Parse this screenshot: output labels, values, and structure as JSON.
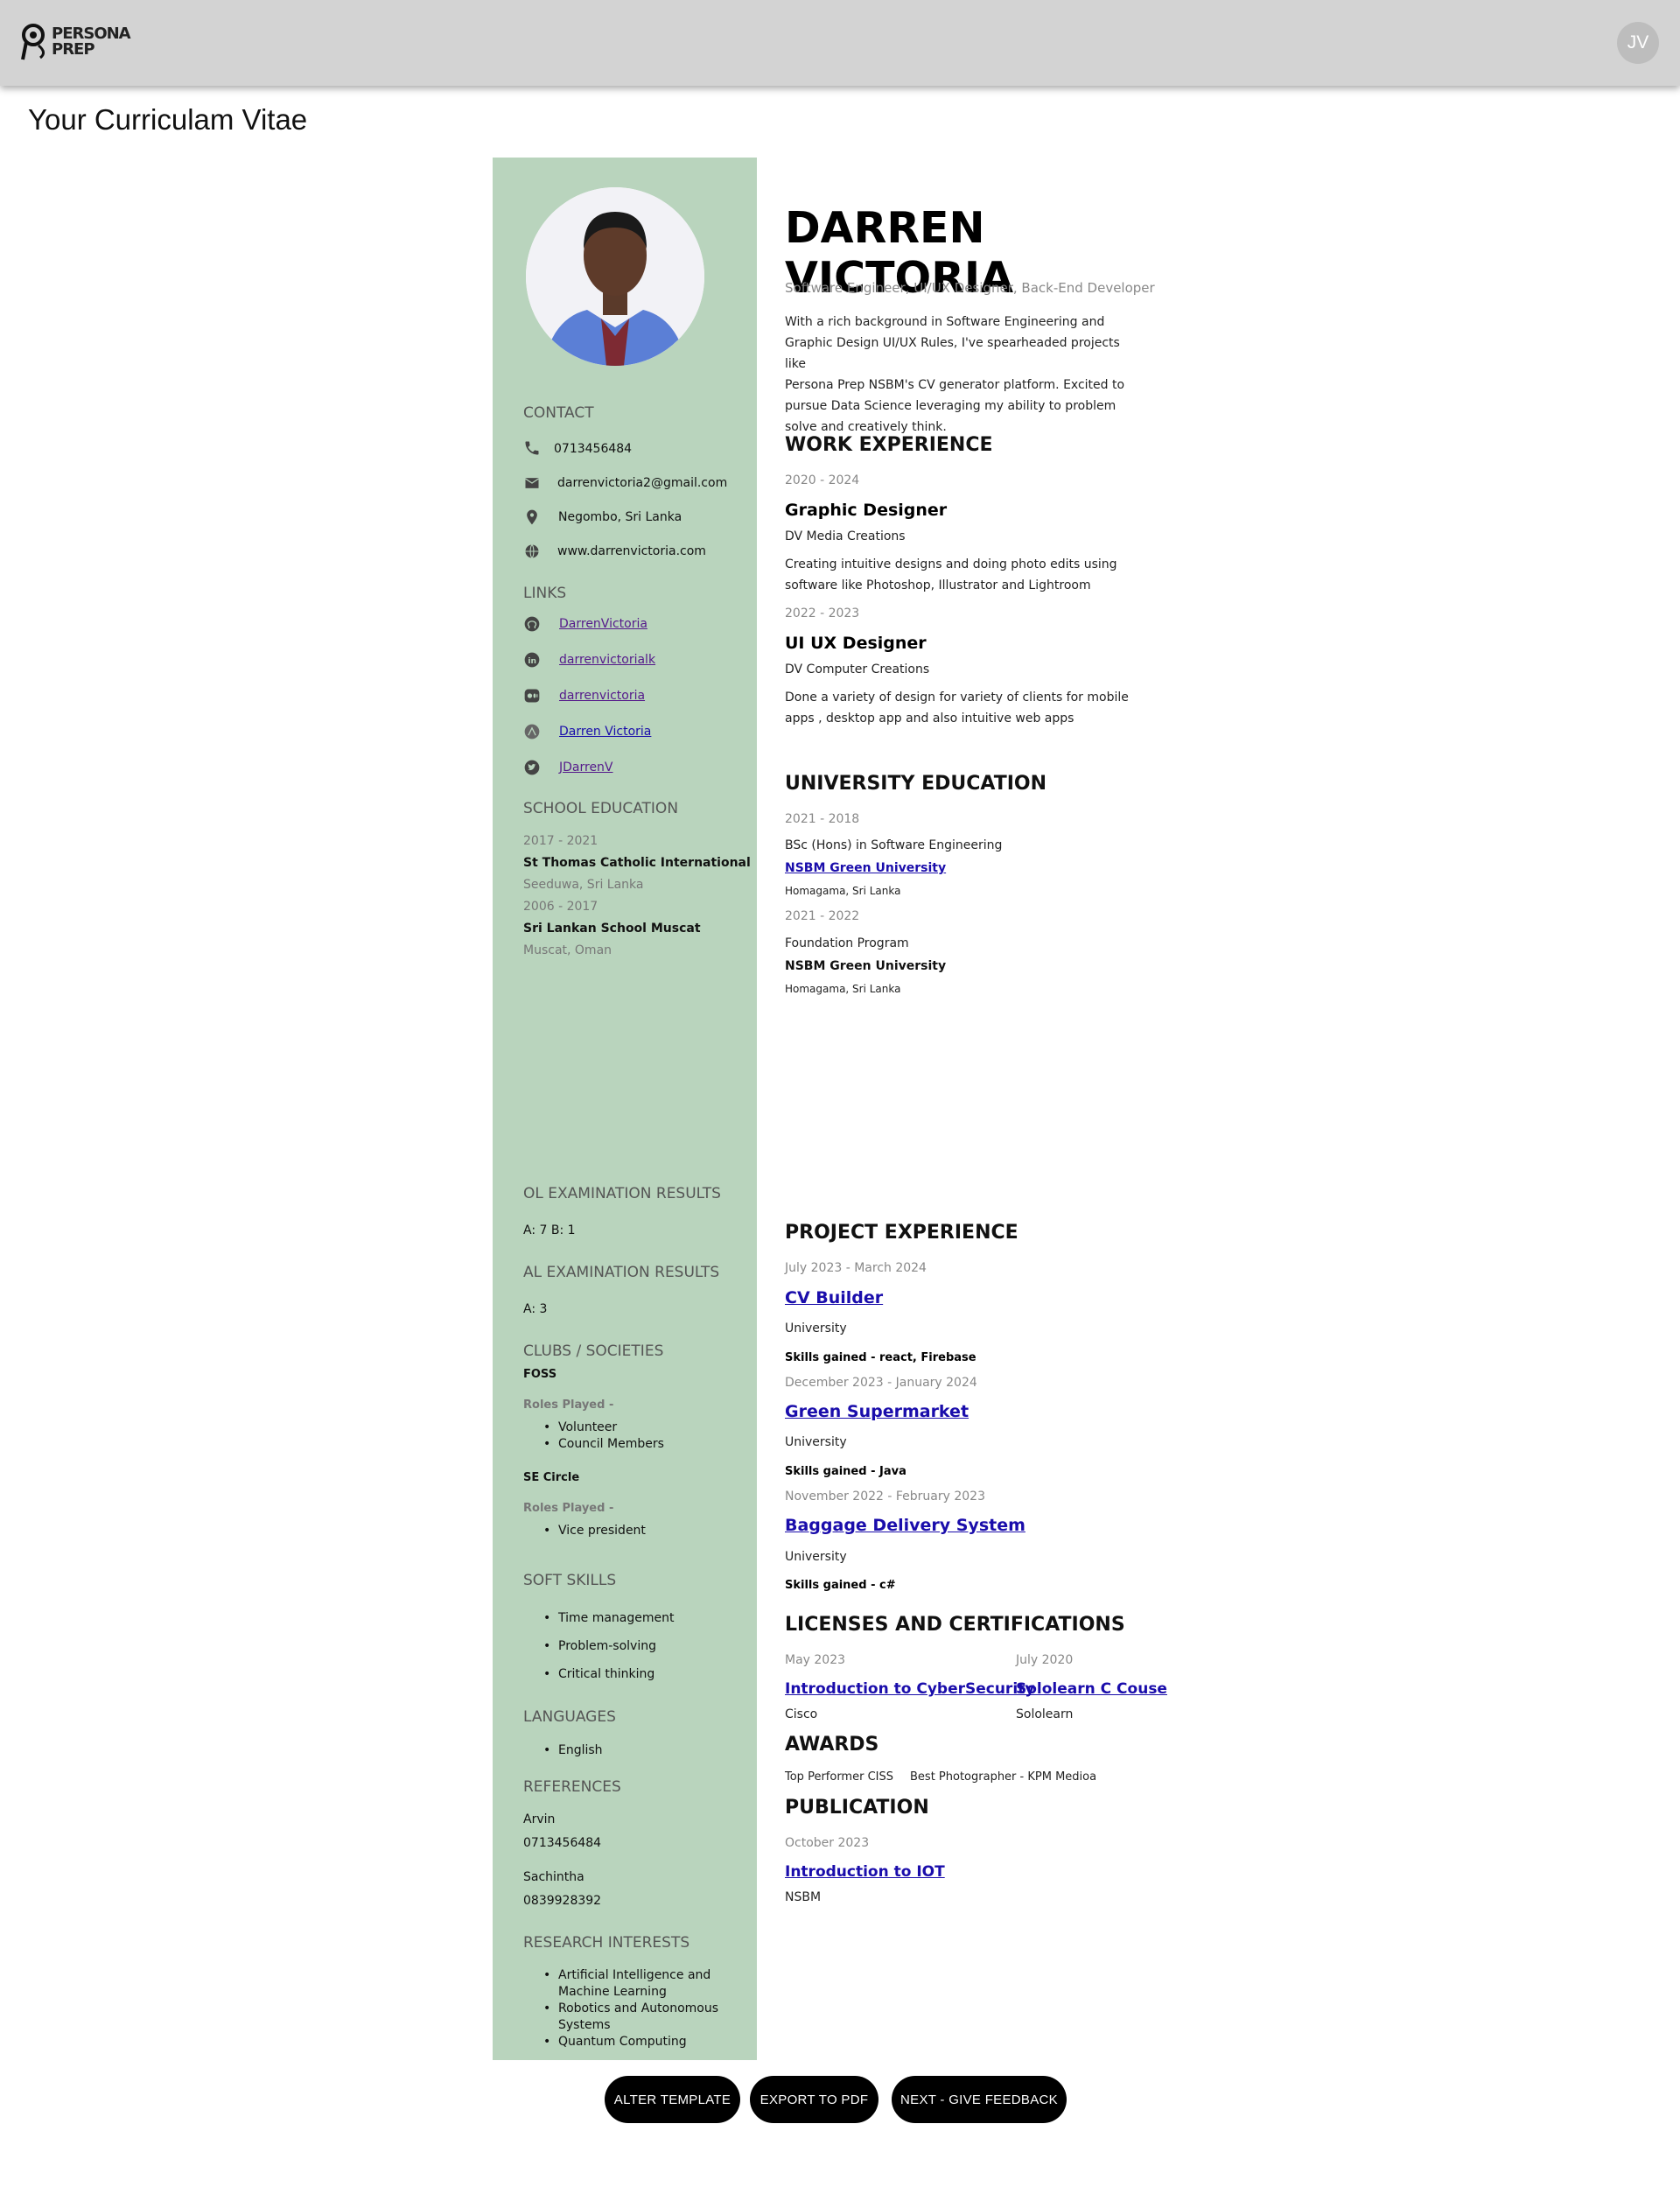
{
  "header": {
    "logo_text": "PERSONA PREP",
    "avatar_initials": "JV"
  },
  "page_title": "Your Curriculam Vitae",
  "cv": {
    "name": "DARREN VICTORIA",
    "tagline": "Software Engineer, UI/UX Designer, Back-End Developer",
    "summary": [
      "With a rich background in Software Engineering and",
      "Graphic Design UI/UX Rules, I've spearheaded projects like",
      "Persona Prep NSBM's CV generator platform. Excited to",
      "pursue Data Science leveraging my ability to problem",
      "solve and creatively think."
    ],
    "contact": {
      "heading": "CONTACT",
      "phone": "0713456484",
      "email": "darrenvictoria2@gmail.com",
      "location": "Negombo, Sri Lanka",
      "website": "www.darrenvictoria.com"
    },
    "links": {
      "heading": "LINKS",
      "github": "DarrenVictoria",
      "linkedin": "darrenvictorialk",
      "medium": "darrenvictoria",
      "behance": "Darren Victoria",
      "twitter": "JDarrenV"
    },
    "school_education": {
      "heading": "SCHOOL EDUCATION",
      "items": [
        {
          "years": "2017 - 2021",
          "school": "St Thomas Catholic International",
          "place": "Seeduwa, Sri Lanka"
        },
        {
          "years": "2006 - 2017",
          "school": "Sri Lankan School Muscat",
          "place": "Muscat, Oman"
        }
      ]
    },
    "ol": {
      "heading": "OL EXAMINATION RESULTS",
      "value": "A: 7 B: 1"
    },
    "al": {
      "heading": "AL EXAMINATION RESULTS",
      "value": "A: 3"
    },
    "clubs": {
      "heading": "CLUBS / SOCIETIES",
      "items": [
        {
          "name": "FOSS",
          "roles_label": "Roles Played -",
          "roles": [
            "Volunteer",
            "Council Members"
          ]
        },
        {
          "name": "SE Circle",
          "roles_label": "Roles Played -",
          "roles": [
            "Vice president"
          ]
        }
      ]
    },
    "soft_skills": {
      "heading": "SOFT SKILLS",
      "items": [
        "Time management",
        "Problem-solving",
        "Critical thinking"
      ]
    },
    "languages": {
      "heading": "LANGUAGES",
      "items": [
        "English"
      ]
    },
    "references": {
      "heading": "REFERENCES",
      "items": [
        {
          "name": "Arvin",
          "phone": "0713456484"
        },
        {
          "name": "Sachintha",
          "phone": "0839928392"
        }
      ]
    },
    "research": {
      "heading": "RESEARCH INTERESTS",
      "items": [
        [
          "Artificial Intelligence and",
          "Machine Learning"
        ],
        [
          "Robotics and Autonomous",
          "Systems"
        ],
        [
          "Quantum Computing"
        ]
      ]
    },
    "work": {
      "heading": "WORK EXPERIENCE",
      "items": [
        {
          "years": "2020 - 2024",
          "title": "Graphic Designer",
          "company": "DV Media Creations",
          "desc": [
            "Creating intuitive designs and doing photo edits using",
            "software like Photoshop, Illustrator and Lightroom"
          ]
        },
        {
          "years": "2022 - 2023",
          "title": "UI UX Designer",
          "company": "DV Computer Creations",
          "desc": [
            "Done a variety of design for variety of clients for mobile",
            "apps , desktop app and also intuitive web apps"
          ]
        }
      ]
    },
    "university": {
      "heading": "UNIVERSITY EDUCATION",
      "items": [
        {
          "years": "2021 - 2018",
          "degree": "BSc (Hons) in Software Engineering",
          "institution": "NSBM Green University",
          "place": "Homagama, Sri Lanka"
        },
        {
          "years": "2021 - 2022",
          "degree": "Foundation Program",
          "institution": "NSBM Green University",
          "place": "Homagama, Sri Lanka"
        }
      ]
    },
    "projects": {
      "heading": "PROJECT EXPERIENCE",
      "items": [
        {
          "dates": "July 2023 - March 2024",
          "title": "CV Builder",
          "org": "University",
          "skills": "Skills gained - react, Firebase"
        },
        {
          "dates": "December 2023 - January 2024",
          "title": "Green Supermarket",
          "org": "University",
          "skills": "Skills gained - Java"
        },
        {
          "dates": "November 2022 - February 2023",
          "title": "Baggage Delivery System",
          "org": "University",
          "skills": "Skills gained - c#"
        }
      ]
    },
    "licenses": {
      "heading": "LICENSES AND CERTIFICATIONS",
      "items": [
        {
          "date": "May 2023",
          "title": "Introduction to CyberSecurity",
          "issuer": "Cisco"
        },
        {
          "date": "July 2020",
          "title": "Sololearn C Couse",
          "issuer": "Sololearn"
        }
      ]
    },
    "awards": {
      "heading": "AWARDS",
      "items": [
        "Top Performer CISS",
        "Best Photographer - KPM Medioa"
      ]
    },
    "publication": {
      "heading": "PUBLICATION",
      "date": "October 2023",
      "title": "Introduction to IOT",
      "publisher": "NSBM"
    }
  },
  "buttons": {
    "alter": "ALTER TEMPLATE",
    "export": "EXPORT TO PDF",
    "next": "NEXT - GIVE FEEDBACK"
  }
}
